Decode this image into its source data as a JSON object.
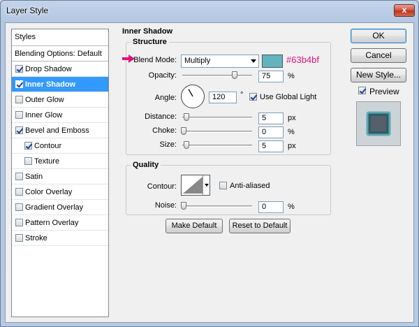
{
  "window": {
    "title": "Layer Style",
    "close_glyph": "x"
  },
  "styles_panel": {
    "header": "Styles",
    "blending_options": "Blending Options: Default",
    "items": [
      {
        "label": "Drop Shadow",
        "checked": true
      },
      {
        "label": "Inner Shadow",
        "checked": true,
        "selected": true
      },
      {
        "label": "Outer Glow",
        "checked": false
      },
      {
        "label": "Inner Glow",
        "checked": false
      },
      {
        "label": "Bevel and Emboss",
        "checked": true
      },
      {
        "label": "Contour",
        "checked": true,
        "indent": true
      },
      {
        "label": "Texture",
        "checked": false,
        "indent": true
      },
      {
        "label": "Satin",
        "checked": false
      },
      {
        "label": "Color Overlay",
        "checked": false
      },
      {
        "label": "Gradient Overlay",
        "checked": false
      },
      {
        "label": "Pattern Overlay",
        "checked": false
      },
      {
        "label": "Stroke",
        "checked": false
      }
    ]
  },
  "inner_shadow": {
    "title": "Inner Shadow",
    "structure": {
      "title": "Structure",
      "blend_mode_label": "Blend Mode:",
      "blend_mode_value": "Multiply",
      "color_swatch": "#63b4bf",
      "color_annotation": "#63b4bf",
      "opacity_label": "Opacity:",
      "opacity_value": "75",
      "opacity_unit": "%",
      "angle_label": "Angle:",
      "angle_value": "120",
      "angle_unit": "°",
      "use_global_light_label": "Use Global Light",
      "use_global_light_checked": true,
      "distance_label": "Distance:",
      "distance_value": "5",
      "distance_unit": "px",
      "choke_label": "Choke:",
      "choke_value": "0",
      "choke_unit": "%",
      "size_label": "Size:",
      "size_value": "5",
      "size_unit": "px"
    },
    "quality": {
      "title": "Quality",
      "contour_label": "Contour:",
      "anti_aliased_label": "Anti-aliased",
      "anti_aliased_checked": false,
      "noise_label": "Noise:",
      "noise_value": "0",
      "noise_unit": "%"
    },
    "make_default_label": "Make Default",
    "reset_default_label": "Reset to Default"
  },
  "buttons": {
    "ok": "OK",
    "cancel": "Cancel",
    "new_style": "New Style...",
    "preview_label": "Preview",
    "preview_checked": true
  },
  "colors": {
    "accent_annotation": "#e0137b",
    "selection": "#3399ff",
    "swatch": "#63b4bf"
  }
}
